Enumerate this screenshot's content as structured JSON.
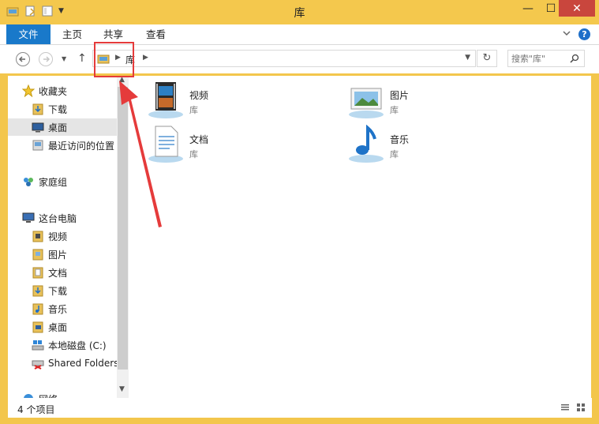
{
  "window": {
    "title": "库",
    "buttons": {
      "minimize": "—",
      "maximize": "☐",
      "close": "✕"
    }
  },
  "ribbon": {
    "tabs": [
      "文件",
      "主页",
      "共享",
      "查看"
    ],
    "help": "?"
  },
  "address": {
    "crumb": "库",
    "search_placeholder": "搜索\"库\""
  },
  "nav": {
    "favorites": {
      "label": "收藏夹",
      "items": [
        "下载",
        "桌面",
        "最近访问的位置"
      ]
    },
    "homegroup": "家庭组",
    "thispc": {
      "label": "这台电脑",
      "items": [
        "视频",
        "图片",
        "文档",
        "下载",
        "音乐",
        "桌面",
        "本地磁盘 (C:)",
        "Shared Folders"
      ]
    },
    "network": "网络",
    "selected": "桌面"
  },
  "libraries": [
    {
      "name": "视频",
      "type": "库",
      "icon": "video-library-icon"
    },
    {
      "name": "图片",
      "type": "库",
      "icon": "pictures-library-icon"
    },
    {
      "name": "文档",
      "type": "库",
      "icon": "documents-library-icon"
    },
    {
      "name": "音乐",
      "type": "库",
      "icon": "music-library-icon"
    }
  ],
  "status": {
    "count": "4 个项目"
  },
  "colors": {
    "titlebar": "#f4c84d",
    "file_tab": "#1979ca",
    "close": "#c9463d",
    "highlight": "#e53b3b"
  }
}
